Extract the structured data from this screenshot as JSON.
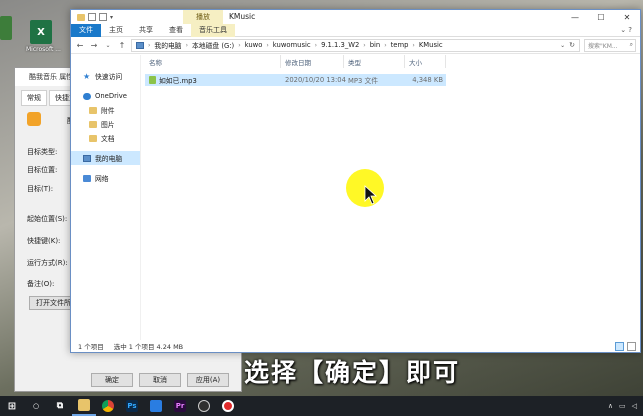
{
  "desktop": {
    "excel_label": "Microsoft ...",
    "icon_colors": {
      "left": "#3d7d3a",
      "excel": "#1f7244"
    }
  },
  "props_dialog": {
    "title": "酷我音乐 属性",
    "tabs": [
      "常规",
      "快捷方式"
    ],
    "name_fragment": "酷",
    "rows": [
      "目标类型:",
      "目标位置:",
      "目标(T):",
      "起始位置(S):",
      "快捷键(K):",
      "运行方式(R):",
      "备注(O):"
    ],
    "open_location_button": "打开文件所在",
    "ok_button": "确定",
    "cancel_button": "取消",
    "apply_button": "应用(A)"
  },
  "explorer": {
    "title": "KMusic",
    "contextual_tab_header": "播放",
    "ribbon_tabs": [
      "文件",
      "主页",
      "共享",
      "查看",
      "音乐工具"
    ],
    "breadcrumbs": [
      "我的电脑",
      "本地磁盘 (G:)",
      "kuwo",
      "kuwomusic",
      "9.1.1.3_W2",
      "bin",
      "temp",
      "KMusic"
    ],
    "search_placeholder": "搜索\"KM...",
    "nav": {
      "quick_access": "快速访问",
      "onedrive": "OneDrive",
      "onedrive_children": [
        "附件",
        "图片",
        "文档"
      ],
      "this_pc": "我的电脑",
      "network": "网络"
    },
    "columns": {
      "name": "名称",
      "date": "修改日期",
      "type": "类型",
      "size": "大小"
    },
    "files": [
      {
        "name": "如如已.mp3",
        "date": "2020/10/20 13:04",
        "type": "MP3 文件",
        "size": "4,348 KB"
      }
    ],
    "status": {
      "count": "1 个项目",
      "selected": "选中 1 个项目  4.24 MB"
    }
  },
  "caption": "选择【确定】即可",
  "colors": {
    "accent": "#1979ca",
    "selection": "#cce8ff",
    "highlight": "#fff700"
  }
}
